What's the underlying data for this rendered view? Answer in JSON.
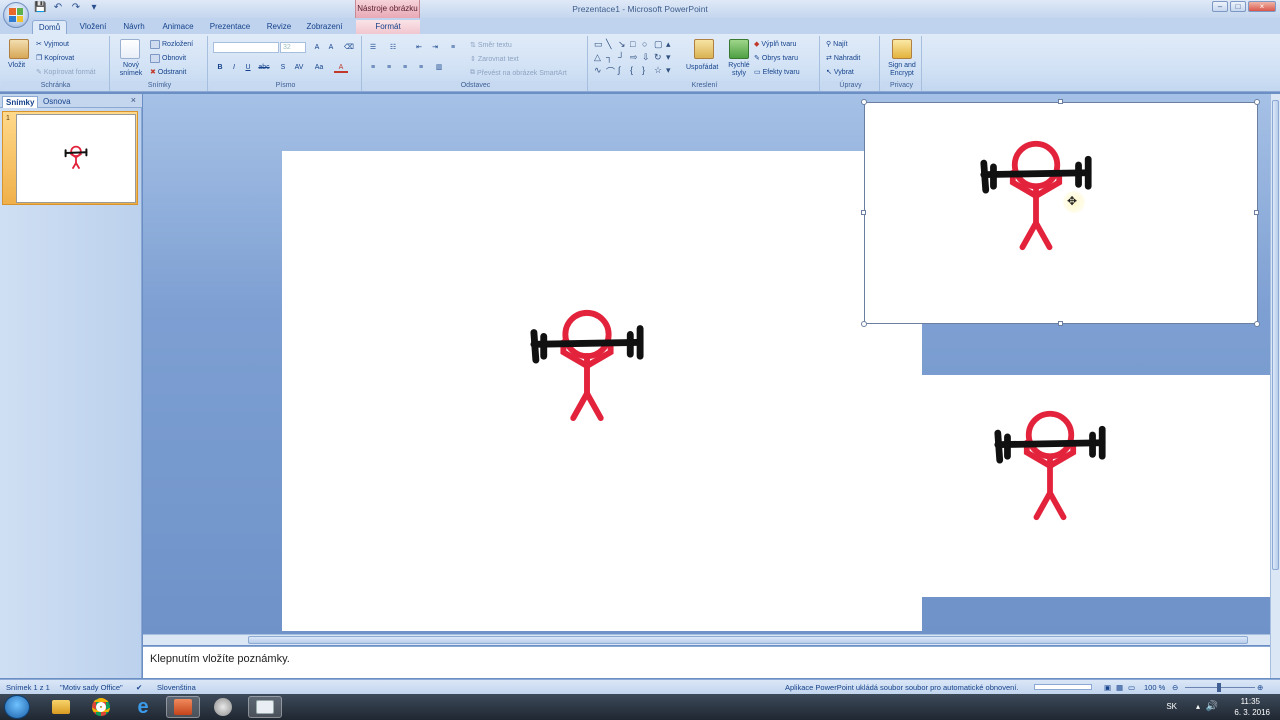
{
  "window": {
    "title": "Prezentace1 - Microsoft PowerPoint",
    "contextual_tab_group": "Nástroje obrázku",
    "controls": [
      "–",
      "□",
      "×"
    ]
  },
  "tabs": [
    "Domů",
    "Vložení",
    "Návrh",
    "Animace",
    "Prezentace",
    "Revize",
    "Zobrazení",
    "Formát"
  ],
  "ribbon": {
    "clipboard": {
      "label": "Schránka",
      "paste": "Vložit",
      "cut": "Vyjmout",
      "copy": "Kopírovat",
      "format_painter": "Kopírovat formát"
    },
    "slides": {
      "label": "Snímky",
      "new_slide": "Nový snímek",
      "layout": "Rozložení",
      "reset": "Obnovit",
      "delete": "Odstranit"
    },
    "font": {
      "label": "Písmo",
      "size": "32",
      "bold": "B",
      "italic": "I",
      "underline": "U",
      "strike": "abc",
      "shadow": "S",
      "spacing": "AV",
      "case": "Aa",
      "color": "A"
    },
    "paragraph": {
      "label": "Odstavec",
      "text_direction": "Směr textu",
      "align_text": "Zarovnat text",
      "smartart": "Převést na obrázek SmartArt"
    },
    "drawing": {
      "label": "Kreslení",
      "arrange": "Uspořádat",
      "quick_styles": "Rychlé styly",
      "shape_fill": "Výplň tvaru",
      "shape_outline": "Obrys tvaru",
      "shape_effects": "Efekty tvaru"
    },
    "editing": {
      "label": "Úpravy",
      "find": "Najít",
      "replace": "Nahradit",
      "select": "Vybrat"
    },
    "privacy": {
      "label": "Privacy",
      "sign": "Sign and Encrypt"
    }
  },
  "slides_pane": {
    "tab_slides": "Snímky",
    "tab_outline": "Osnova",
    "close": "×",
    "slide_number": "1"
  },
  "notes": {
    "placeholder": "Klepnutím vložíte poznámky."
  },
  "status": {
    "slide": "Snímek 1 z 1",
    "theme": "\"Motiv sady Office\"",
    "language": "Slovenština",
    "message": "Aplikace PowerPoint ukládá soubor soubor pro automatické obnovení.",
    "zoom": "100 %"
  },
  "taskbar": {
    "lang": "SK",
    "time": "11:35",
    "date": "6. 3. 2016"
  },
  "colors": {
    "stick_red": "#e3223c",
    "bar_black": "#111111",
    "workspace_blue": "#7d9fd2"
  }
}
